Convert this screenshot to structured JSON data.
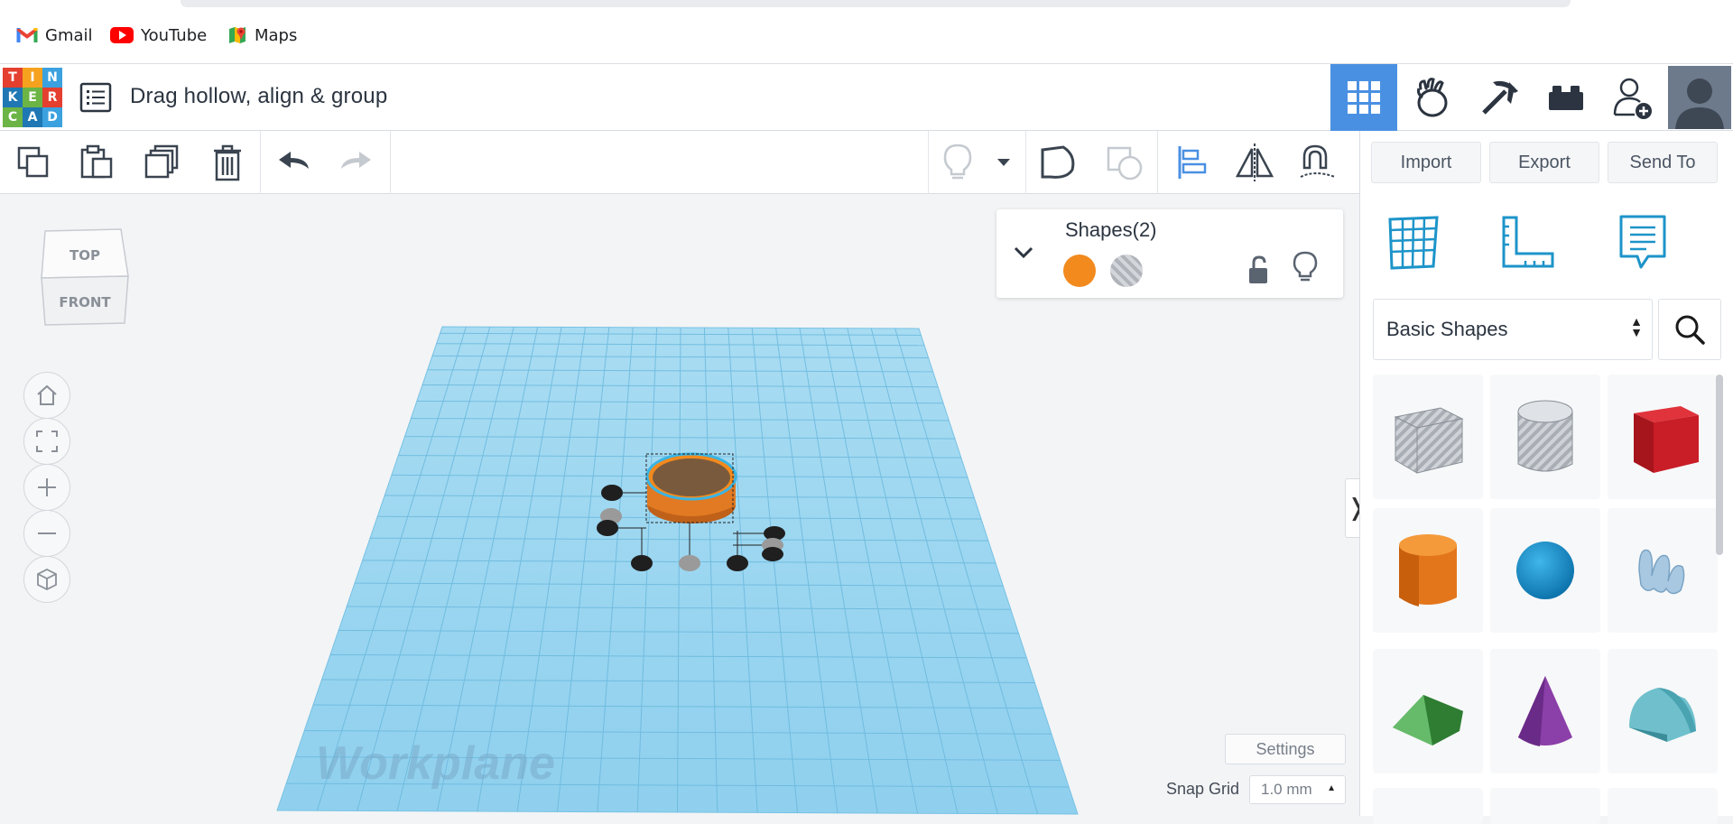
{
  "bookmarks": [
    {
      "label": "Gmail",
      "icon": "gmail-icon"
    },
    {
      "label": "YouTube",
      "icon": "youtube-icon"
    },
    {
      "label": "Maps",
      "icon": "maps-icon"
    }
  ],
  "logo": {
    "letters": [
      "T",
      "I",
      "N",
      "K",
      "E",
      "R",
      "C",
      "A",
      "D"
    ]
  },
  "header": {
    "title": "Drag hollow, align & group",
    "nav": [
      "3d-design-grid-icon",
      "sim-lab-icon",
      "minecraft-pickaxe-icon",
      "bricks-icon",
      "add-user-icon",
      "avatar"
    ]
  },
  "toolbar": {
    "buttons": [
      "copy",
      "paste",
      "duplicate",
      "delete",
      "undo",
      "redo",
      "light",
      "group",
      "ungroup",
      "align",
      "mirror",
      "cruise"
    ],
    "import_label": "Import",
    "export_label": "Export",
    "send_label": "Send To"
  },
  "viewcube": {
    "top_label": "TOP",
    "front_label": "FRONT"
  },
  "inspector": {
    "title": "Shapes(2)",
    "solid_color": "#f28a1e"
  },
  "panel": {
    "category": "Basic Shapes",
    "shapes": [
      "Box Hole",
      "Cylinder Hole",
      "Box",
      "Cylinder",
      "Sphere",
      "Scribble",
      "Roof",
      "Cone",
      "Round Roof"
    ]
  },
  "workplane": {
    "label": "Workplane",
    "settings_label": "Settings",
    "snap_label": "Snap Grid",
    "snap_value": "1.0 mm"
  },
  "colors": {
    "accent": "#4a90e2",
    "grid": "#8fd2ee",
    "orange": "#f28a1e"
  }
}
